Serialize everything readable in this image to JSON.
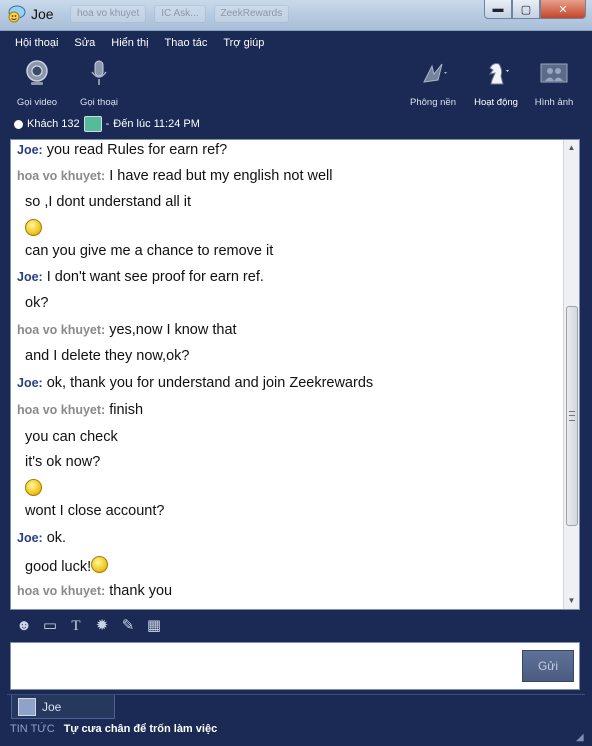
{
  "window": {
    "title": "Joe",
    "background_tabs": [
      "hoa vo khuyet",
      "IC Ask...",
      "ZeekRewards"
    ],
    "controls": {
      "minimize": "▬",
      "maximize": "▢",
      "close": "✕"
    }
  },
  "menu": [
    "Hội thoại",
    "Sửa",
    "Hiển thị",
    "Thao tác",
    "Trợ giúp"
  ],
  "toolbar": {
    "video_call": "Gọi video",
    "voice_call": "Gọi thoại",
    "background": "Phông nền",
    "activities": "Hoạt động",
    "picture": "Hình ảnh"
  },
  "status": {
    "guests": "Khách 132",
    "separator": "-",
    "until": "Đến lúc 11:24 PM"
  },
  "chat": {
    "messages": [
      {
        "sender": "Joe:",
        "text": "you read Rules  for earn ref?"
      },
      {
        "sender": "hoa vo khuyet:",
        "text": "I have read but my english not well"
      },
      {
        "sender": "",
        "text": "so ,I dont understand all it"
      },
      {
        "sender": "",
        "text": "",
        "emoji": "worried"
      },
      {
        "sender": "",
        "text": "can you give me a chance to remove it"
      },
      {
        "sender": "Joe:",
        "text": "I don't want see proof for earn ref."
      },
      {
        "sender": "",
        "text": "ok?"
      },
      {
        "sender": "hoa vo khuyet:",
        "text": "yes,now I know that"
      },
      {
        "sender": "",
        "text": "and I delete they now,ok?"
      },
      {
        "sender": "Joe:",
        "text": "ok, thank you for understand and join Zeekrewards"
      },
      {
        "sender": "hoa vo khuyet:",
        "text": "finish"
      },
      {
        "sender": "",
        "text": "you can check"
      },
      {
        "sender": "",
        "text": "it's ok now?"
      },
      {
        "sender": "",
        "text": "",
        "emoji": "grin"
      },
      {
        "sender": "",
        "text": "wont I close account?"
      },
      {
        "sender": "Joe:",
        "text": "ok."
      },
      {
        "sender": "",
        "text": "good luck!",
        "emoji": "smile"
      },
      {
        "sender": "hoa vo khuyet:",
        "text": "thank you"
      }
    ]
  },
  "compose": {
    "send_label": "Gửi"
  },
  "tabs": [
    {
      "label": "Joe"
    }
  ],
  "news": {
    "label": "TIN TỨC",
    "headline": "Tự cưa chân để trốn làm việc"
  },
  "colors": {
    "window_bg": "#1b2a55",
    "joe_name": "#2a3f82",
    "guest_name": "#8a8a8a"
  }
}
